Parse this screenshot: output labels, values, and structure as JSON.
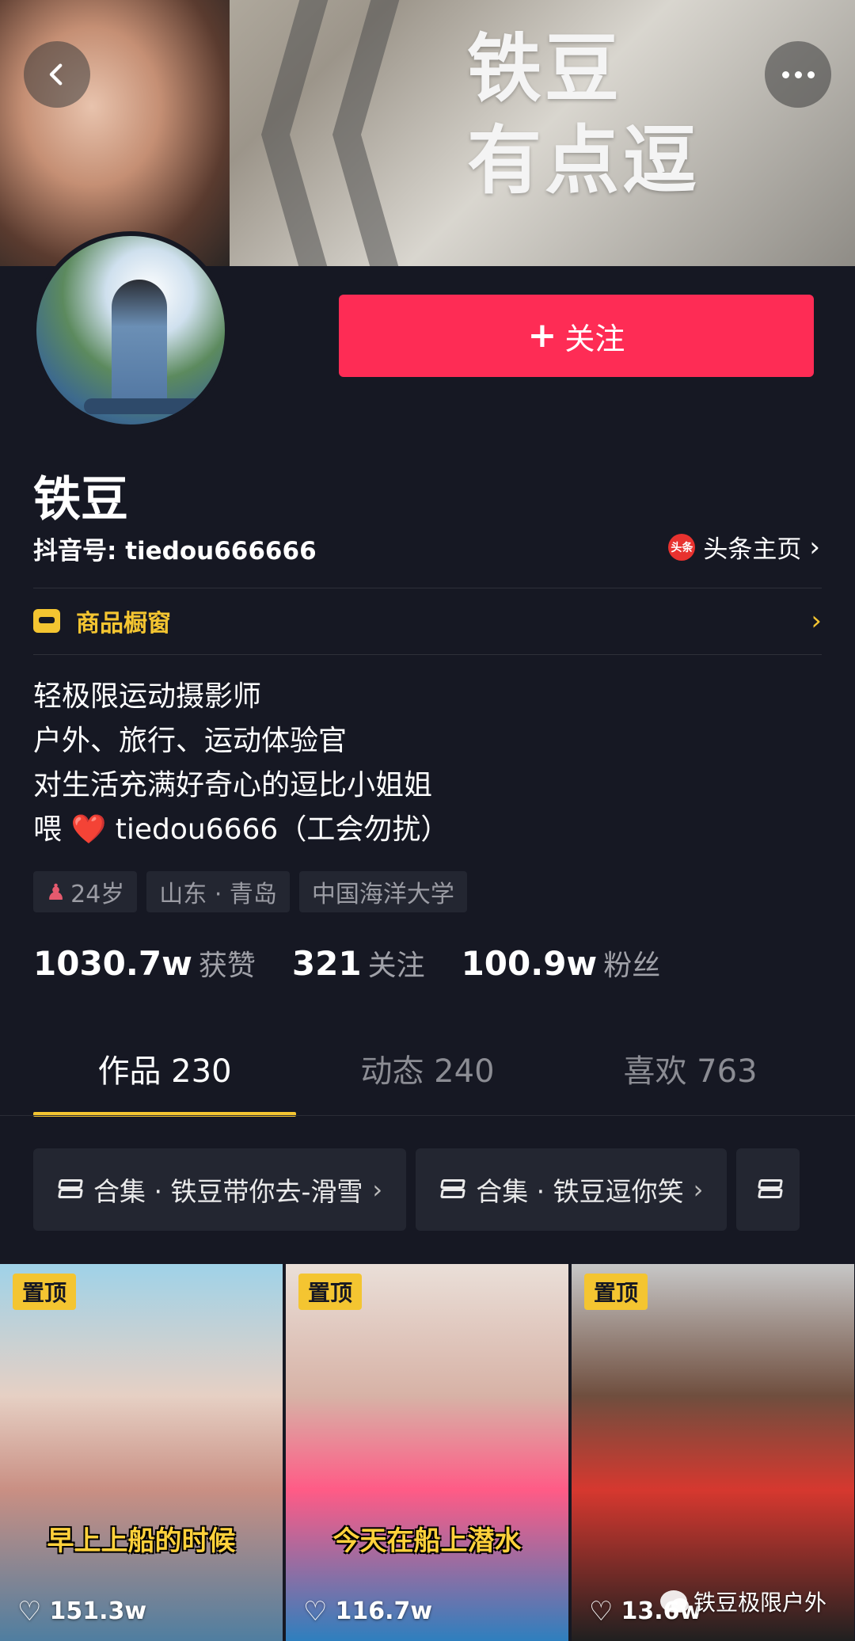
{
  "banner": {
    "title_line1": "铁豆",
    "title_line2": "有点逗"
  },
  "header": {
    "back_icon": "back-chevron-icon",
    "more_icon": "more-dots-icon"
  },
  "profile": {
    "follow_label": "关注",
    "follow_plus": "+",
    "name": "铁豆",
    "douyin_id": "抖音号: tiedou666666",
    "toutiao_label": "头条主页",
    "toutiao_logo_text": "头条",
    "shop_label": "商品橱窗",
    "bio": [
      "轻极限运动摄影师",
      "户外、旅行、运动体验官",
      "对生活充满好奇心的逗比小姐姐"
    ],
    "bio_contact_prefix": "喂",
    "bio_contact_heart": "❤️",
    "bio_contact_suffix": "tiedou6666（工会勿扰）",
    "tags": {
      "age": "24岁",
      "location": "山东 · 青岛",
      "school": "中国海洋大学"
    }
  },
  "stats": {
    "likes_num": "1030.7w",
    "likes_label": "获赞",
    "following_num": "321",
    "following_label": "关注",
    "followers_num": "100.9w",
    "followers_label": "粉丝"
  },
  "tabs": {
    "works": "作品 230",
    "activity": "动态 240",
    "liked": "喜欢 763"
  },
  "collections": [
    {
      "label": "合集 · 铁豆带你去-滑雪"
    },
    {
      "label": "合集 · 铁豆逗你笑"
    }
  ],
  "videos": [
    {
      "pin": "置顶",
      "caption": "早上上船的时候",
      "likes": "151.3w"
    },
    {
      "pin": "置顶",
      "caption": "今天在船上潜水",
      "likes": "116.7w"
    },
    {
      "pin": "置顶",
      "caption": "",
      "likes": "13.6w"
    }
  ],
  "watermark": "铁豆极限户外",
  "colors": {
    "background": "#161823",
    "follow_button": "#fe2c55",
    "accent_yellow": "#f4c531"
  }
}
